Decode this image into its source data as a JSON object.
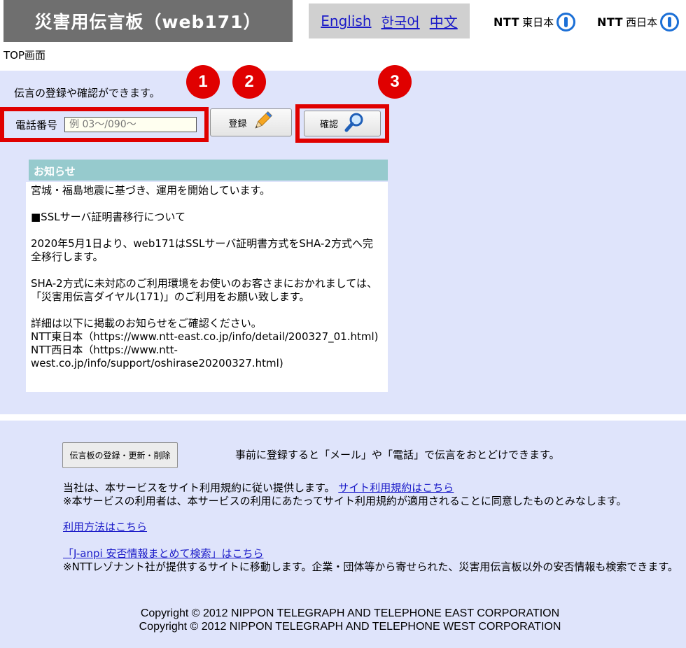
{
  "header": {
    "title": "災害用伝言板（web171）",
    "languages": [
      "English",
      "한국어",
      "中文"
    ],
    "logos": [
      {
        "brand": "NTT",
        "region": "東日本"
      },
      {
        "brand": "NTT",
        "region": "西日本"
      }
    ]
  },
  "screen_name": "TOP画面",
  "main": {
    "lead": "伝言の登録や確認ができます。",
    "phone_label": "電話番号",
    "phone_placeholder": "例 03〜/090〜",
    "register_label": "登録",
    "confirm_label": "確認",
    "badges": [
      "1",
      "2",
      "3"
    ]
  },
  "notice": {
    "heading": "お知らせ",
    "paragraphs": [
      "宮城・福島地震に基づき、運用を開始しています。",
      "■SSLサーバ証明書移行について",
      "2020年5月1日より、web171はSSLサーバ証明書方式をSHA-2方式へ完全移行します。",
      "SHA-2方式に未対応のご利用環境をお使いのお客さまにおかれましては、「災害用伝言ダイヤル(171)」のご利用をお願い致します。",
      "詳細は以下に掲載のお知らせをご確認ください。"
    ],
    "links": [
      "NTT東日本（https://www.ntt-east.co.jp/info/detail/200327_01.html)",
      "NTT西日本（https://www.ntt-west.co.jp/info/support/oshirase20200327.html)"
    ]
  },
  "footer": {
    "manage_button": "伝言板の登録・更新・削除",
    "manage_desc": "事前に登録すると「メール」や「電話」で伝言をおとどけできます。",
    "terms_text": "当社は、本サービスをサイト利用規約に従い提供します。",
    "terms_link": "サイト利用規約はこちら",
    "terms_note": "※本サービスの利用者は、本サービスの利用にあたってサイト利用規約が適用されることに同意したものとみなします。",
    "usage_link": "利用方法はこちら",
    "janpi_link": "「J-anpi 安否情報まとめて検索」はこちら",
    "janpi_note": "※NTTレゾナント社が提供するサイトに移動します。企業・団体等から寄せられた、災害用伝言板以外の安否情報も検索できます。",
    "copyright_east": "Copyright © 2012 NIPPON TELEGRAPH AND TELEPHONE EAST CORPORATION",
    "copyright_west": "Copyright © 2012 NIPPON TELEGRAPH AND TELEPHONE WEST CORPORATION"
  },
  "colors": {
    "title_bar": "#6f6f6f",
    "panel_bg": "#dfe4fb",
    "highlight_red": "#e00000",
    "notice_head": "#96cacd",
    "link": "#1a1ac8"
  },
  "icons": [
    "pencil-icon",
    "magnifier-icon",
    "ntt-logo-icon"
  ]
}
